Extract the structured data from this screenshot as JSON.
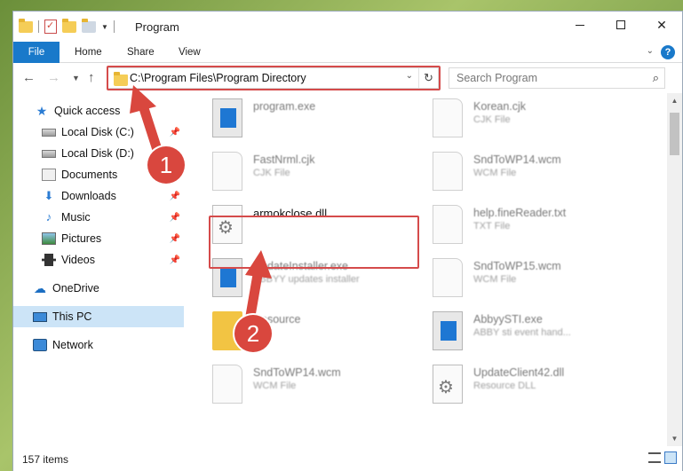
{
  "window": {
    "title": "Program",
    "buttons": {
      "minimize": "—",
      "maximize": "",
      "close": "✕"
    }
  },
  "ribbon": {
    "tabs": [
      "File",
      "Home",
      "Share",
      "View"
    ]
  },
  "nav": {
    "address": "C:\\Program Files\\Program Directory",
    "search_placeholder": "Search Program"
  },
  "sidebar": {
    "items": [
      {
        "label": "Quick access",
        "icon": "star-icon",
        "pinned": false
      },
      {
        "label": "Local Disk (C:)",
        "icon": "disk-icon",
        "pinned": true
      },
      {
        "label": "Local Disk (D:)",
        "icon": "disk-icon",
        "pinned": false
      },
      {
        "label": "Documents",
        "icon": "documents-icon",
        "pinned": true
      },
      {
        "label": "Downloads",
        "icon": "downloads-icon",
        "pinned": true
      },
      {
        "label": "Music",
        "icon": "music-icon",
        "pinned": true
      },
      {
        "label": "Pictures",
        "icon": "pictures-icon",
        "pinned": true
      },
      {
        "label": "Videos",
        "icon": "videos-icon",
        "pinned": true
      },
      {
        "label": "OneDrive",
        "icon": "cloud-icon",
        "pinned": false
      },
      {
        "label": "This PC",
        "icon": "pc-icon",
        "pinned": false,
        "selected": true
      },
      {
        "label": "Network",
        "icon": "network-icon",
        "pinned": false
      }
    ]
  },
  "files": [
    {
      "name": "program.exe",
      "type": ""
    },
    {
      "name": "Korean.cjk",
      "type": "CJK File"
    },
    {
      "name": "FastNrml.cjk",
      "type": "CJK File"
    },
    {
      "name": "SndToWP14.wcm",
      "type": "WCM File"
    },
    {
      "name": "armokclose.dll",
      "type": ""
    },
    {
      "name": "help.fineReader.txt",
      "type": "TXT File"
    },
    {
      "name": "UpdateInstaller.exe",
      "type": "ABBYY updates installer"
    },
    {
      "name": "SndToWP15.wcm",
      "type": "WCM File"
    },
    {
      "name": "Resource",
      "type": ""
    },
    {
      "name": "AbbyySTI.exe",
      "type": "ABBY sti event hand..."
    },
    {
      "name": "SndToWP14.wcm",
      "type": "WCM File"
    },
    {
      "name": "UpdateClient42.dll",
      "type": "Resource DLL"
    }
  ],
  "status": {
    "item_count": "157 items"
  },
  "annotations": {
    "step1": "1",
    "step2": "2"
  },
  "colors": {
    "accent": "#1979ca",
    "highlight": "#d54b4b",
    "selection": "#cce4f7"
  }
}
